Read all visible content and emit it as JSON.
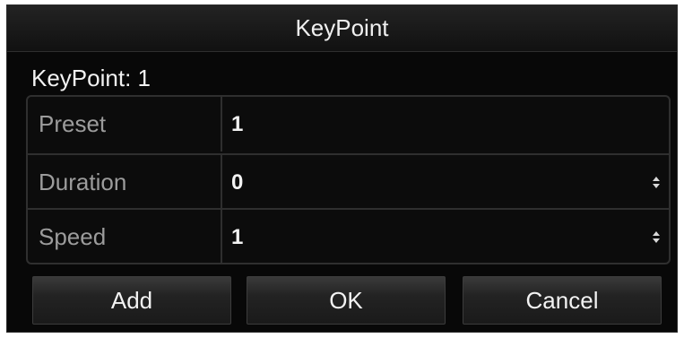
{
  "dialog": {
    "title": "KeyPoint",
    "section_label": "KeyPoint: 1",
    "fields": [
      {
        "label": "Preset",
        "value": "1",
        "has_spinner": false
      },
      {
        "label": "Duration",
        "value": "0",
        "has_spinner": true
      },
      {
        "label": "Speed",
        "value": "1",
        "has_spinner": true
      }
    ],
    "buttons": {
      "add": "Add",
      "ok": "OK",
      "cancel": "Cancel"
    }
  },
  "colors": {
    "background": "#080808",
    "text_primary": "#f2f2f2",
    "text_label": "#9c9c9c",
    "border": "#2f2f2f"
  },
  "icons": {
    "spinner": "up-down-chevron-icon"
  }
}
